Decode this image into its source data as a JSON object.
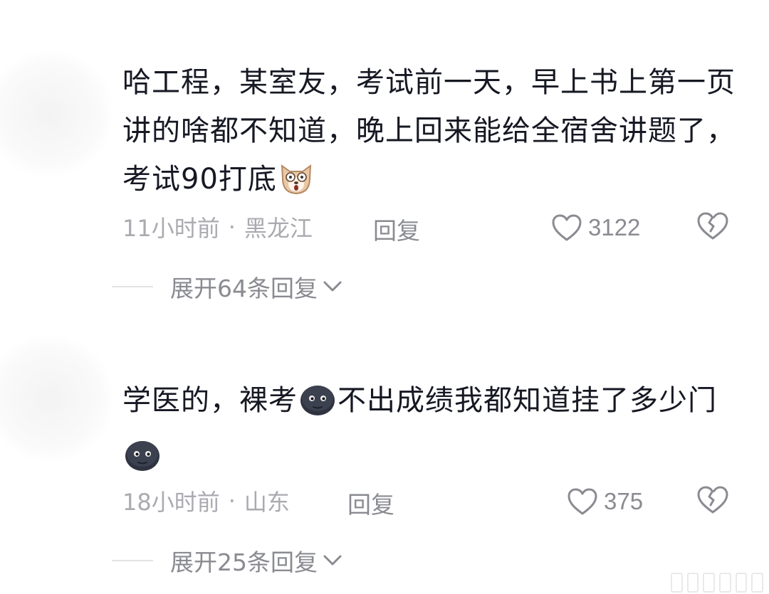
{
  "comments": [
    {
      "text_before": "哈工程，某室友，考试前一天，早上书上第一页讲的啥都不知道，晚上回来能给全宿舍讲题了，考试90打底",
      "time": "11小时前",
      "separator": "·",
      "location": "黑龙江",
      "reply_label": "回复",
      "likes": "3122",
      "expand_label": "展开64条回复"
    },
    {
      "text_part1": "学医的，裸考",
      "text_part2": "不出成绩我都知道挂了多少门",
      "time": "18小时前",
      "separator": "·",
      "location": "山东",
      "reply_label": "回复",
      "likes": "375",
      "expand_label": "展开25条回复"
    }
  ],
  "icons": {
    "like": "heart-outline-icon",
    "dislike": "broken-heart-icon",
    "expand": "chevron-down-icon",
    "emoji_dog": "shocked-dog-emoji",
    "emoji_moon": "new-moon-face-emoji"
  },
  "colors": {
    "text": "#161823",
    "meta": "#aaaab0",
    "action": "#8a8b91"
  }
}
